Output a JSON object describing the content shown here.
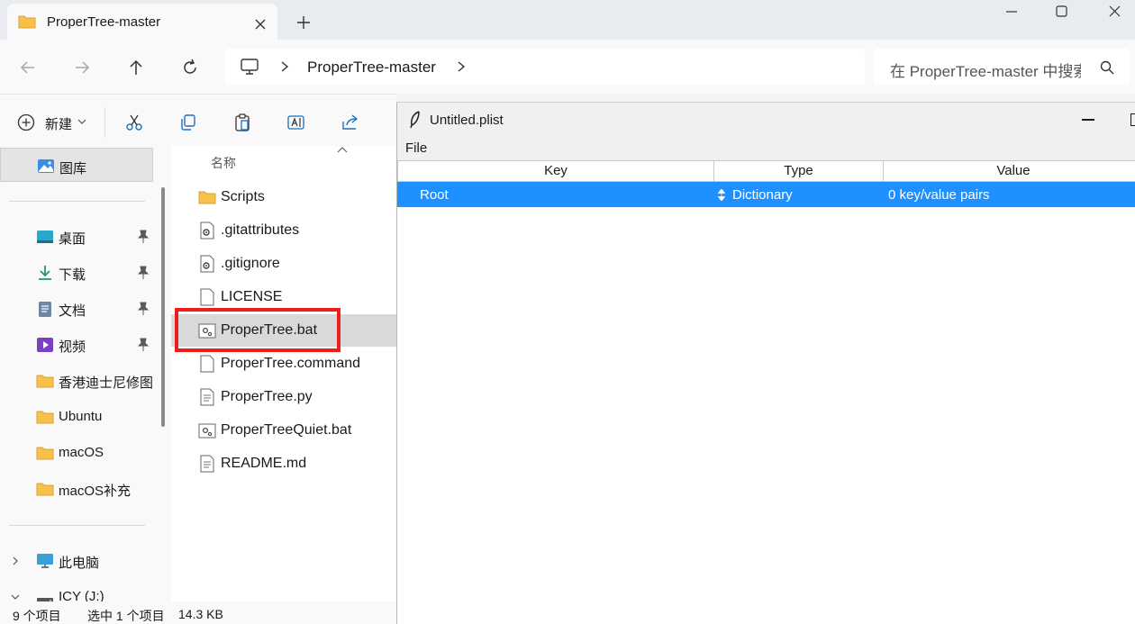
{
  "window": {
    "tab_title": "ProperTree-master",
    "tab_icon": "folder-icon"
  },
  "address": {
    "breadcrumb": "ProperTree-master",
    "search_placeholder": "在 ProperTree-master 中搜索"
  },
  "toolbar": {
    "new_label": "新建",
    "icons": [
      "cut-icon",
      "copy-icon",
      "paste-icon",
      "rename-icon",
      "share-icon"
    ]
  },
  "sidebar": {
    "gallery_label": "图库",
    "pinned": [
      {
        "label": "桌面",
        "icon": "desktop-icon"
      },
      {
        "label": "下载",
        "icon": "download-icon"
      },
      {
        "label": "文档",
        "icon": "document-icon"
      },
      {
        "label": "视频",
        "icon": "video-icon"
      }
    ],
    "folders": [
      {
        "label": "香港迪士尼修图",
        "icon": "folder-icon"
      },
      {
        "label": "Ubuntu",
        "icon": "folder-icon"
      },
      {
        "label": "macOS",
        "icon": "folder-icon"
      },
      {
        "label": "macOS补充",
        "icon": "folder-icon"
      }
    ],
    "this_pc": "此电脑",
    "drive": "ICY (J:)"
  },
  "file_list": {
    "column_name": "名称",
    "files": [
      {
        "name": "Scripts",
        "icon": "folder-icon"
      },
      {
        "name": ".gitattributes",
        "icon": "settings-file-icon"
      },
      {
        "name": ".gitignore",
        "icon": "settings-file-icon"
      },
      {
        "name": "LICENSE",
        "icon": "blank-file-icon"
      },
      {
        "name": "ProperTree.bat",
        "icon": "batch-file-icon",
        "selected": true
      },
      {
        "name": "ProperTree.command",
        "icon": "blank-file-icon"
      },
      {
        "name": "ProperTree.py",
        "icon": "text-file-icon"
      },
      {
        "name": "ProperTreeQuiet.bat",
        "icon": "batch-file-icon"
      },
      {
        "name": "README.md",
        "icon": "text-file-icon"
      }
    ]
  },
  "status": {
    "count": "9 个项目",
    "selected": "选中 1 个项目",
    "size": "14.3 KB"
  },
  "propertree": {
    "title": "Untitled.plist",
    "menu_file": "File",
    "columns": {
      "key": "Key",
      "type": "Type",
      "value": "Value"
    },
    "row": {
      "key": "Root",
      "type": "Dictionary",
      "value": "0 key/value pairs"
    },
    "selection_color": "#1e90ff"
  },
  "colors": {
    "highlight_box": "#ee1c1c",
    "folder": "#f7c04a"
  }
}
